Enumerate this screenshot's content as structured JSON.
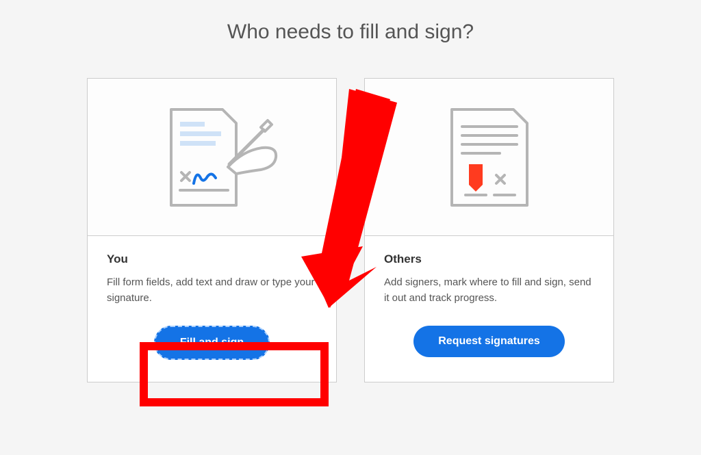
{
  "heading": "Who needs to fill and sign?",
  "cards": {
    "you": {
      "title": "You",
      "desc": "Fill form fields, add text and draw or type your signature.",
      "button": "Fill and sign"
    },
    "others": {
      "title": "Others",
      "desc": "Add signers, mark where to fill and sign, send it out and track progress.",
      "button": "Request signatures"
    }
  }
}
